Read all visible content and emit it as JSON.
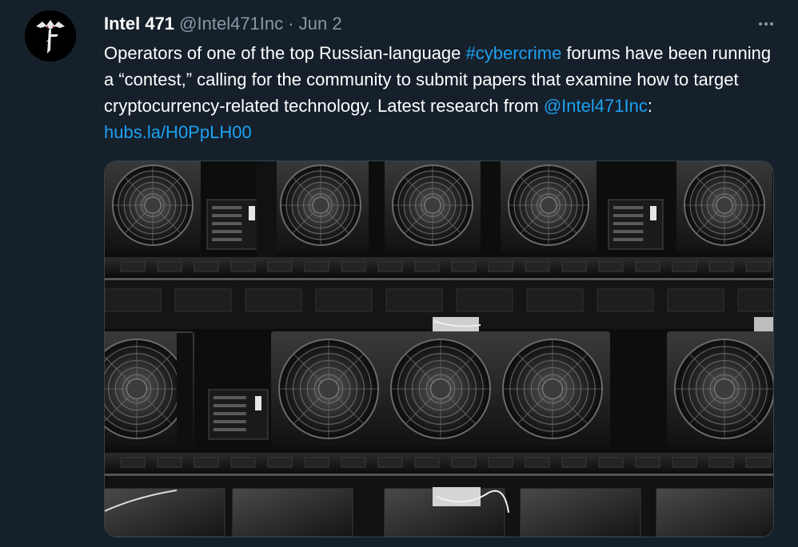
{
  "tweet": {
    "author": {
      "display_name": "Intel 471",
      "handle": "@Intel471Inc",
      "separator": "·",
      "date": "Jun 2",
      "avatar_icon": "intel471-logo-icon"
    },
    "more_icon": "more-options-icon",
    "text": {
      "part1": "Operators of one of the top Russian-language ",
      "hashtag": "#cybercrime",
      "part2": " forums have been running a “contest,” calling for the community to submit papers that examine how to target cryptocurrency-related technology. Latest research from ",
      "mention": "@Intel471Inc",
      "colon": ": ",
      "url": "hubs.la/H0PpLH00"
    },
    "media": {
      "kind": "photo",
      "subject": "crypto-mining-rig-fans"
    }
  },
  "colors": {
    "background": "#15202b",
    "text": "#ffffff",
    "secondary": "#8899a6",
    "link": "#1da1f2",
    "border": "#38444d"
  }
}
